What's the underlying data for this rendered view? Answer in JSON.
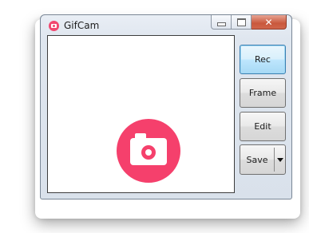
{
  "window": {
    "title": "GifCam",
    "close_glyph": "✕"
  },
  "icons": {
    "app_icon": "camera-icon",
    "canvas_logo": "camera-logo-icon",
    "minimize": "minimize-icon",
    "maximize": "maximize-icon",
    "close": "close-icon",
    "save_dropdown": "chevron-down-icon"
  },
  "buttons": {
    "rec": "Rec",
    "frame": "Frame",
    "edit": "Edit",
    "save": "Save"
  },
  "colors": {
    "brand_pink": "#f5406c",
    "rec_highlight": "#bee6fd",
    "close_button": "#c9583d"
  }
}
